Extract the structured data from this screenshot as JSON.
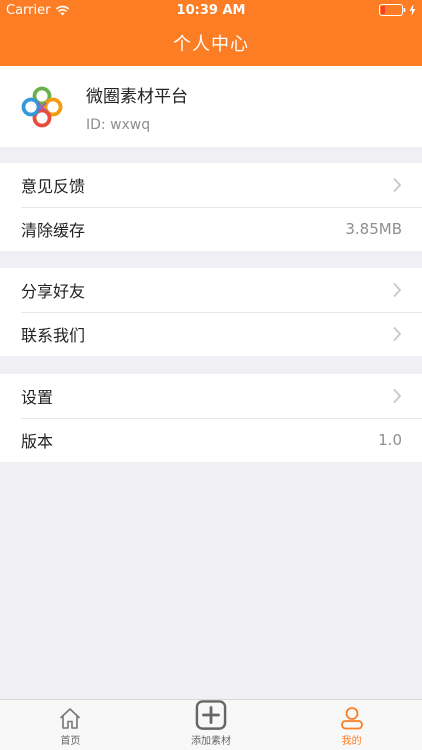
{
  "status_bar": {
    "carrier": "Carrier",
    "time": "10:39 AM"
  },
  "nav": {
    "title": "个人中心"
  },
  "profile": {
    "name": "微圈素材平台",
    "id_text": "ID: wxwq"
  },
  "groups": [
    [
      {
        "label": "意见反馈",
        "value": "",
        "chevron": true
      },
      {
        "label": "清除缓存",
        "value": "3.85MB",
        "chevron": false
      }
    ],
    [
      {
        "label": "分享好友",
        "value": "",
        "chevron": true
      },
      {
        "label": "联系我们",
        "value": "",
        "chevron": true
      }
    ],
    [
      {
        "label": "设置",
        "value": "",
        "chevron": true
      },
      {
        "label": "版本",
        "value": "1.0",
        "chevron": false
      }
    ]
  ],
  "tabs": [
    {
      "label": "首页",
      "icon": "home-icon",
      "active": false
    },
    {
      "label": "添加素材",
      "icon": "add-icon",
      "active": false
    },
    {
      "label": "我的",
      "icon": "user-icon",
      "active": true
    }
  ],
  "colors": {
    "accent": "#fd7d25",
    "background": "#efeff4",
    "tab_inactive": "#666666"
  }
}
